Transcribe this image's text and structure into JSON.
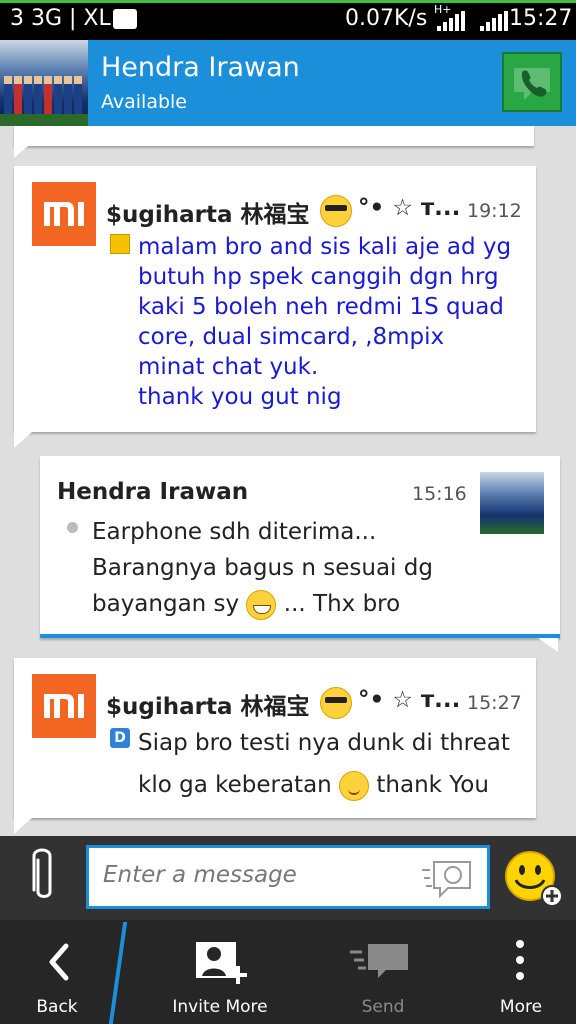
{
  "status_bar": {
    "left_text": "3 3G | XL",
    "speed": "0.07K/s",
    "network_type": "H+",
    "time": "15:27"
  },
  "header": {
    "contact_name": "Hendra Irawan",
    "contact_status": "Available"
  },
  "messages": [
    {
      "sender": "$ugiharta 林福宝",
      "sender_suffix": "°• ☆ т...",
      "time": "19:12",
      "lines": [
        "malam bro and sis kali aje ad yg",
        "butuh hp spek canggih dgn hrg",
        "kaki 5 boleh neh redmi 1S quad",
        "core, dual simcard, ,8mpix",
        "minat chat yuk.",
        "thank you gut nig"
      ],
      "text_color": "#1a1ad6"
    },
    {
      "sender": "Hendra Irawan",
      "time": "15:16",
      "line1": "Earphone sdh diterima...",
      "line2": "Barangnya bagus n sesuai dg",
      "line3_a": "bayangan sy",
      "line3_b": "... Thx bro"
    },
    {
      "sender": "$ugiharta 林福宝",
      "sender_suffix": "°• ☆ т...",
      "time": "15:27",
      "line1": "Siap bro testi nya dunk di threat",
      "line2_a": "klo ga keberatan",
      "line2_b": "thank You"
    }
  ],
  "compose": {
    "placeholder": "Enter a message"
  },
  "bottom_bar": {
    "back": "Back",
    "invite": "Invite More",
    "send": "Send",
    "more": "More"
  },
  "colors": {
    "header_blue": "#1b8fd9",
    "mi_orange": "#f26522",
    "broadcast_text": "#1a1ad6"
  }
}
